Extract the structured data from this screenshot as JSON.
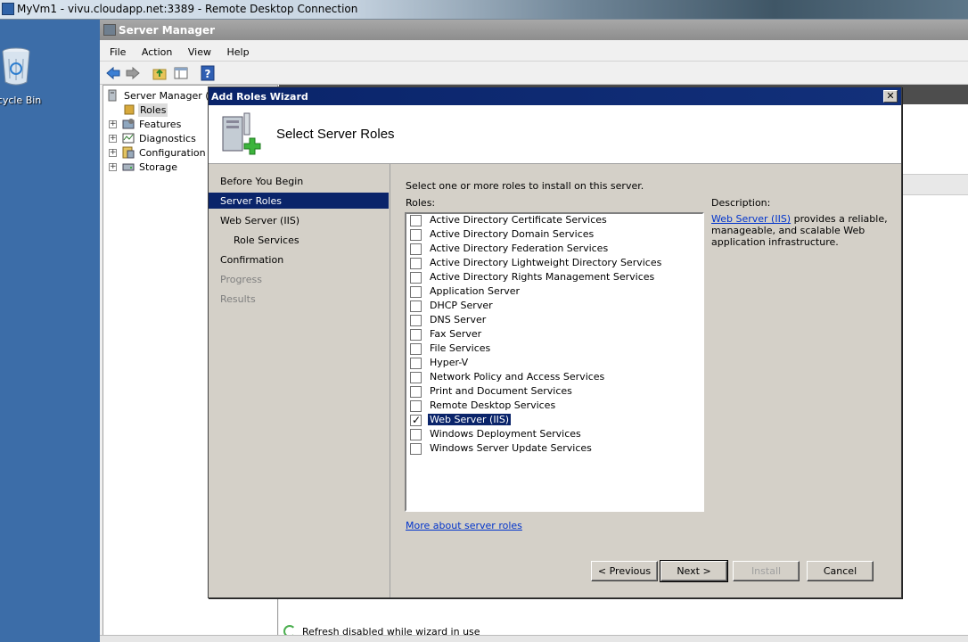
{
  "rdp": {
    "title": "MyVm1 - vivu.cloudapp.net:3389 - Remote Desktop Connection"
  },
  "desktop": {
    "recycle_bin_label": "ecycle Bin"
  },
  "server_manager": {
    "title": "Server Manager",
    "menu": [
      "File",
      "Action",
      "View",
      "Help"
    ],
    "tree": {
      "root": "Server Manager (M",
      "items": [
        {
          "label": "Roles",
          "icon": "roles-icon"
        },
        {
          "label": "Features",
          "icon": "features-icon"
        },
        {
          "label": "Diagnostics",
          "icon": "diagnostics-icon"
        },
        {
          "label": "Configuration",
          "icon": "configuration-icon"
        },
        {
          "label": "Storage",
          "icon": "storage-icon"
        }
      ]
    },
    "status": "Refresh disabled while wizard in use"
  },
  "wizard": {
    "title": "Add Roles Wizard",
    "header_title": "Select Server Roles",
    "steps": [
      {
        "label": "Before You Begin",
        "state": "normal"
      },
      {
        "label": "Server Roles",
        "state": "active"
      },
      {
        "label": "Web Server (IIS)",
        "state": "normal"
      },
      {
        "label": "Role Services",
        "state": "sub"
      },
      {
        "label": "Confirmation",
        "state": "normal"
      },
      {
        "label": "Progress",
        "state": "disabled"
      },
      {
        "label": "Results",
        "state": "disabled"
      }
    ],
    "instruction": "Select one or more roles to install on this server.",
    "roles_label": "Roles:",
    "roles": [
      {
        "label": "Active Directory Certificate Services",
        "checked": false
      },
      {
        "label": "Active Directory Domain Services",
        "checked": false
      },
      {
        "label": "Active Directory Federation Services",
        "checked": false
      },
      {
        "label": "Active Directory Lightweight Directory Services",
        "checked": false
      },
      {
        "label": "Active Directory Rights Management Services",
        "checked": false
      },
      {
        "label": "Application Server",
        "checked": false
      },
      {
        "label": "DHCP Server",
        "checked": false
      },
      {
        "label": "DNS Server",
        "checked": false
      },
      {
        "label": "Fax Server",
        "checked": false
      },
      {
        "label": "File Services",
        "checked": false
      },
      {
        "label": "Hyper-V",
        "checked": false
      },
      {
        "label": "Network Policy and Access Services",
        "checked": false
      },
      {
        "label": "Print and Document Services",
        "checked": false
      },
      {
        "label": "Remote Desktop Services",
        "checked": false
      },
      {
        "label": "Web Server (IIS)",
        "checked": true,
        "selected": true
      },
      {
        "label": "Windows Deployment Services",
        "checked": false
      },
      {
        "label": "Windows Server Update Services",
        "checked": false
      }
    ],
    "description_label": "Description:",
    "description_link": "Web Server (IIS)",
    "description_text": " provides a reliable, manageable, and scalable Web application infrastructure.",
    "more_link": "More about server roles",
    "buttons": {
      "previous": "< Previous",
      "next": "Next >",
      "install": "Install",
      "cancel": "Cancel"
    }
  },
  "colors": {
    "titlebar": "#0a246a",
    "dialog_bg": "#d4d0c8",
    "link": "#0033cc",
    "desktop": "#3c6da8"
  }
}
